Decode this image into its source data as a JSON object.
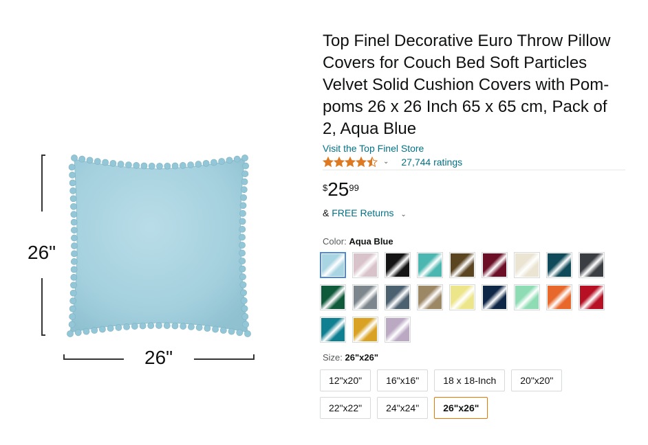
{
  "image": {
    "dim_height_label": "26\"",
    "dim_width_label": "26\""
  },
  "product": {
    "title": "Top Finel Decorative Euro Throw Pillow Covers for Couch Bed Soft Particles Velvet Solid Cushion Covers with Pom-poms 26 x 26 Inch 65 x 65 cm, Pack of 2, Aqua Blue",
    "store_link": "Visit the Top Finel Store",
    "rating": 4.5,
    "ratings_count": "27,744 ratings",
    "price": {
      "symbol": "$",
      "whole": "25",
      "fraction": "99"
    },
    "returns_prefix": "&",
    "returns_link": "FREE Returns",
    "color_label": "Color:",
    "color_value": "Aqua Blue",
    "swatch_colors": [
      "#a9d4e2",
      "#d9c3cb",
      "#141414",
      "#4cb7b0",
      "#5b4420",
      "#6b0e26",
      "#ebe4d2",
      "#0f4a5a",
      "#3a3d42",
      "#0e5a3a",
      "#7c868c",
      "#4c6170",
      "#9d8866",
      "#ece58a",
      "#0f2747",
      "#8ddcb3",
      "#e8672a",
      "#b70f24",
      "#0f7f92",
      "#d9a224",
      "#bba9c4"
    ],
    "selected_swatch": 0,
    "size_label": "Size:",
    "size_value": "26\"x26\"",
    "sizes": [
      "12\"x20\"",
      "16\"x16\"",
      "18 x 18-Inch",
      "20\"x20\"",
      "22\"x22\"",
      "24\"x24\"",
      "26\"x26\""
    ],
    "selected_size": 6,
    "accent_link_color": "#007185",
    "star_color": "#de7921"
  }
}
